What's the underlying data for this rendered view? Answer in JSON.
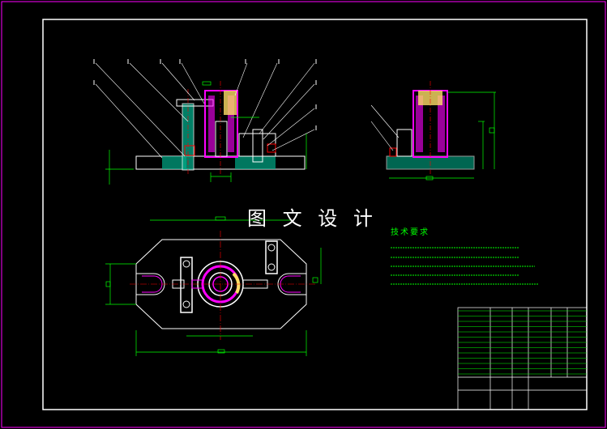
{
  "watermark": "图 文 设 计",
  "technical_requirements": {
    "title": "技术要求",
    "line_count": 5
  },
  "colors": {
    "background": "#000000",
    "border": "#ffffff",
    "outline": "#ffffff",
    "section_fill": "#00aa88",
    "dimension": "#00ff00",
    "highlight": "#ff00ff",
    "leader": "#ffffff",
    "accent": "#ffff00",
    "hatch": "#ffdd66"
  }
}
